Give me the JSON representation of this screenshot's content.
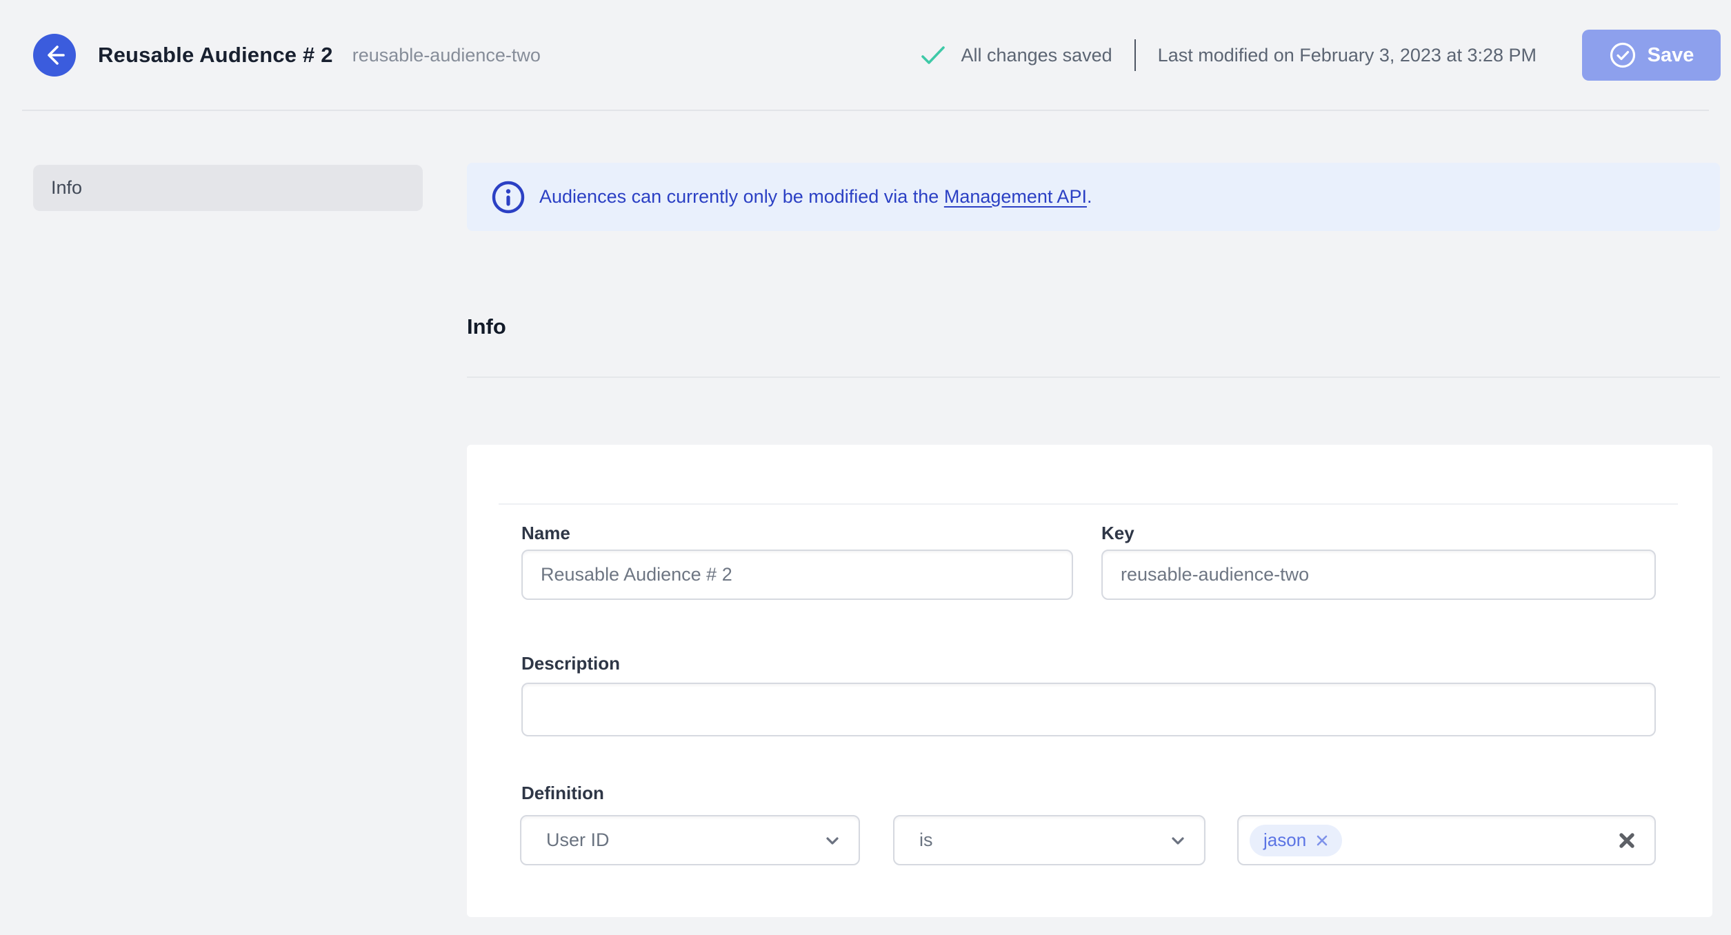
{
  "header": {
    "title": "Reusable Audience # 2",
    "slug": "reusable-audience-two",
    "status": "All changes saved",
    "last_modified": "Last modified on February 3, 2023 at 3:28 PM",
    "save_label": "Save"
  },
  "sidebar": {
    "items": [
      {
        "label": "Info"
      }
    ]
  },
  "banner": {
    "text_prefix": "Audiences can currently only be modified via the ",
    "link_text": "Management API",
    "text_suffix": "."
  },
  "section": {
    "title": "Info"
  },
  "form": {
    "name": {
      "label": "Name",
      "value": "Reusable Audience # 2"
    },
    "key": {
      "label": "Key",
      "value": "reusable-audience-two"
    },
    "description": {
      "label": "Description",
      "value": ""
    },
    "definition": {
      "label": "Definition",
      "trait_selected": "User ID",
      "operator_selected": "is",
      "tags": [
        "jason"
      ]
    }
  },
  "colors": {
    "accent_blue": "#3b5cdd",
    "save_button": "#8da0ed",
    "banner_text": "#2b40c4",
    "success_green": "#3ec9a7",
    "page_bg": "#f2f3f5"
  },
  "icons": {
    "back": "arrow-left-icon",
    "saved": "check-icon",
    "save": "circle-check-icon",
    "banner": "info-circle-icon",
    "select": "chevron-down-icon",
    "chip_remove": "x-icon",
    "field_clear": "x-icon"
  }
}
